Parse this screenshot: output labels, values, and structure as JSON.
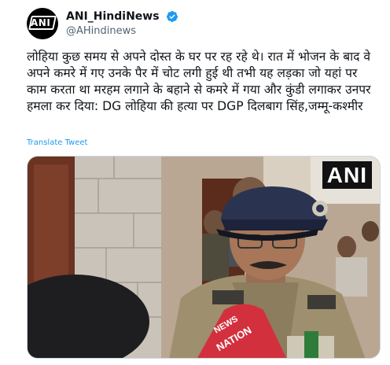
{
  "account": {
    "display_name": "ANI_HindiNews",
    "handle": "@AHindinews",
    "avatar_text": "ANI",
    "verified": true
  },
  "tweet": {
    "text": "लोहिया कुछ समय से अपने दोस्त के घर पर रह रहे थे। रात में भोजन के बाद वे अपने कमरे में गए उनके पैर में चोट लगी हुई थी तभी यह लड़का जो यहां पर काम करता था मरहम लगाने के बहाने से कमरे में गया और कुंडी लगाकर उनपर हमला कर दिया: DG लोहिया की हत्या पर DGP दिलबाग सिंह,जम्मू-कश्मीर",
    "translate_label": "Translate Tweet"
  },
  "media": {
    "watermark": "ANI",
    "mic_label_top": "NEWS",
    "mic_label_bottom": "NATION"
  },
  "colors": {
    "link": "#1d9bf0",
    "verified": "#1d9bf0",
    "text": "#0f1419",
    "secondary": "#536471"
  }
}
